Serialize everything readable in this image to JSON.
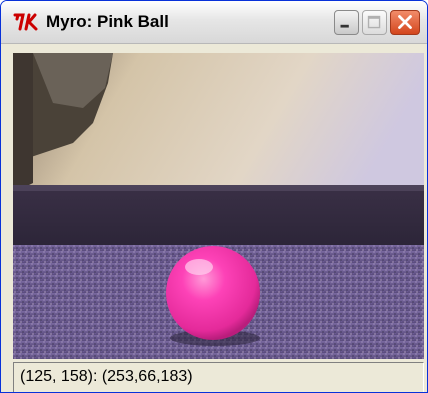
{
  "window": {
    "title": "Myro: Pink Ball",
    "app_icon": "tk-feather-icon",
    "buttons": {
      "minimize_icon": "minimize-icon",
      "maximize_icon": "maximize-icon",
      "close_icon": "close-icon"
    }
  },
  "camera": {
    "image_label": "pink ball on carpet"
  },
  "status": {
    "text": "(125, 158): (253,66,183)"
  },
  "colors": {
    "close_button": "#d3461d",
    "ball": "#fd42b7",
    "title_bar": "#e6e6e6"
  }
}
